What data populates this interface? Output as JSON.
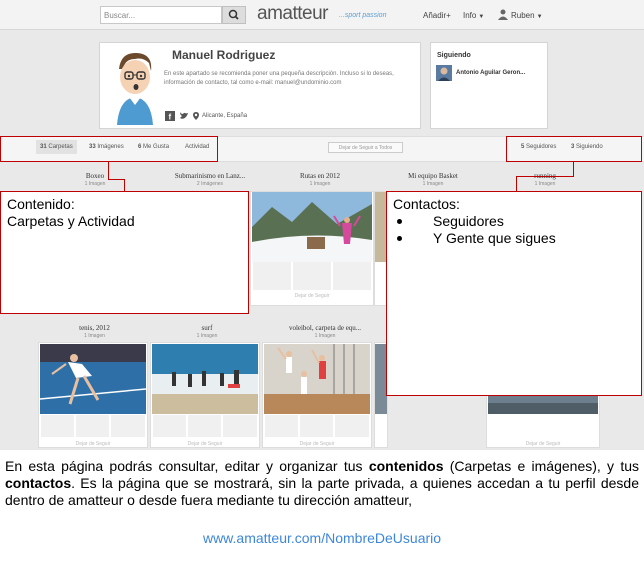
{
  "topbar": {
    "search_placeholder": "Buscar...",
    "logo_text": "amatteur",
    "logo_tagline": "...sport passion",
    "nav_add": "Añadir+",
    "nav_info": "Info",
    "nav_user": "Ruben"
  },
  "profile": {
    "name": "Manuel Rodriguez",
    "description": "En este apartado se recomienda poner una pequeña descripción. Incluso si lo deseas, información de contacto, tal como e-mail: manuel@undominio.com",
    "location": "Alicante, España"
  },
  "following_panel": {
    "title": "Siguiendo",
    "person": "Antonio Aguilar Geron..."
  },
  "tabs": {
    "folders": "Carpetas",
    "folders_count": "31",
    "images": "Imágenes",
    "images_count": "33",
    "likes": "Me Gusta",
    "likes_count": "6",
    "activity": "Actividad",
    "unfollow_all": "Dejar de Seguir a Todos",
    "followers": "Seguidores",
    "followers_count": "5",
    "following": "Siguiendo",
    "following_count": "3"
  },
  "folders_row1": [
    {
      "title": "Boxeo",
      "count": "1 Imagen"
    },
    {
      "title": "Submarinismo en Lanz...",
      "count": "2 Imágenes"
    },
    {
      "title": "Rutas en 2012",
      "count": "1 Imagen"
    },
    {
      "title": "Mi equipo Basket",
      "count": "1 Imagen"
    },
    {
      "title": "running",
      "count": "1 Imagen"
    }
  ],
  "folders_row2": [
    {
      "title": "tenis, 2012",
      "count": "1 Imagen",
      "button": "Dejar de Seguir"
    },
    {
      "title": "surf",
      "count": "1 Imagen",
      "button": "Dejar de Seguir"
    },
    {
      "title": "voleibol, carpeta de equ...",
      "count": "1 Imagen",
      "button": "Dejar de Seguir"
    },
    {
      "title": "",
      "count": "",
      "button": "Dejar de Seguir"
    }
  ],
  "row1_button": "Dejar de Seguir",
  "callout_content": {
    "line1": "Contenido:",
    "line2": "Carpetas y Actividad"
  },
  "callout_contacts": {
    "title": "Contactos:",
    "item1": "Seguidores",
    "item2": "Y Gente que sigues"
  },
  "caption": {
    "part1": "En esta página podrás consultar, editar y organizar tus ",
    "bold1": "contenidos",
    "part2": " (Carpetas e imágenes), y tus ",
    "bold2": "contactos",
    "part3": ". Es la página que se mostrará, sin la parte privada, a quienes accedan a tu perfil desde dentro de amatteur o desde fuera mediante tu dirección amatteur,"
  },
  "url": "www.amatteur.com/NombreDeUsuario",
  "colors": {
    "annotation_red": "#c00000",
    "url_blue": "#3d87d9",
    "brand_blue": "#5aa0d6"
  }
}
